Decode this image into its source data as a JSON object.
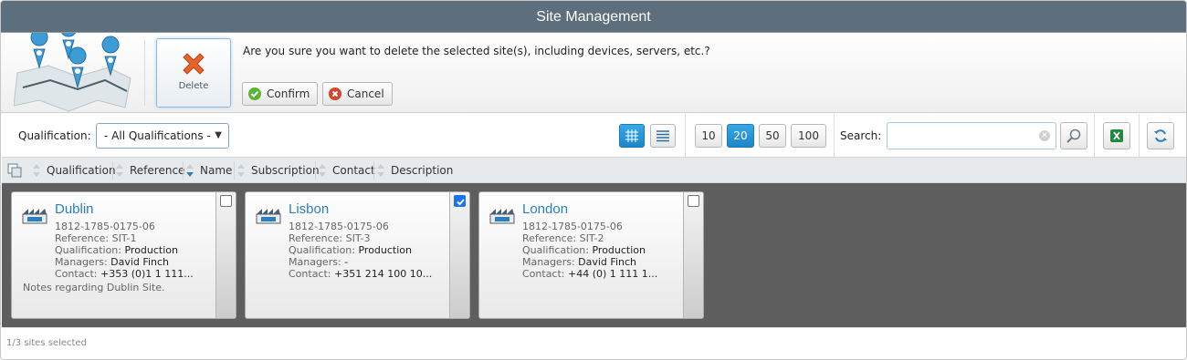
{
  "window": {
    "title": "Site Management"
  },
  "header": {
    "delete_label": "Delete",
    "question": "Are you sure you want to delete the selected site(s), including devices, servers, etc.?",
    "confirm_label": "Confirm",
    "cancel_label": "Cancel"
  },
  "toolbar": {
    "qualification_label": "Qualification:",
    "qualification_selected": "- All Qualifications -",
    "page_sizes": [
      "10",
      "20",
      "50",
      "100"
    ],
    "page_size_selected": "20",
    "search_label": "Search:",
    "search_value": "",
    "view_mode": "grid"
  },
  "sort": {
    "columns": [
      "Qualification",
      "Reference",
      "Name",
      "Subscription",
      "Contact",
      "Description"
    ],
    "active_column": "Name",
    "active_direction": "descending"
  },
  "sites": [
    {
      "name": "Dublin",
      "id": "1812-1785-0175-06",
      "reference_label": "Reference:",
      "reference": "SIT-1",
      "qualification_label": "Qualification:",
      "qualification": "Production",
      "managers_label": "Managers:",
      "managers": "David Finch",
      "contact_label": "Contact:",
      "contact": "+353 (0)1 1 111...",
      "notes": "Notes regarding Dublin Site.",
      "selected": false
    },
    {
      "name": "Lisbon",
      "id": "1812-1785-0175-06",
      "reference_label": "Reference:",
      "reference": "SIT-3",
      "qualification_label": "Qualification:",
      "qualification": "Production",
      "managers_label": "Managers:",
      "managers": "-",
      "contact_label": "Contact:",
      "contact": "+351 214 100 10...",
      "notes": "",
      "selected": true
    },
    {
      "name": "London",
      "id": "1812-1785-0175-06",
      "reference_label": "Reference:",
      "reference": "SIT-2",
      "qualification_label": "Qualification:",
      "qualification": "Production",
      "managers_label": "Managers:",
      "managers": "David Finch",
      "contact_label": "Contact:",
      "contact": "+44 (0) 1 111 1...",
      "notes": "",
      "selected": false
    }
  ],
  "footer": {
    "status": "1/3 sites selected"
  },
  "colors": {
    "titlebar": "#5d6e7c",
    "accent": "#1b86c9",
    "link": "#2a7fc0",
    "content_bg": "#5e5e5e"
  }
}
